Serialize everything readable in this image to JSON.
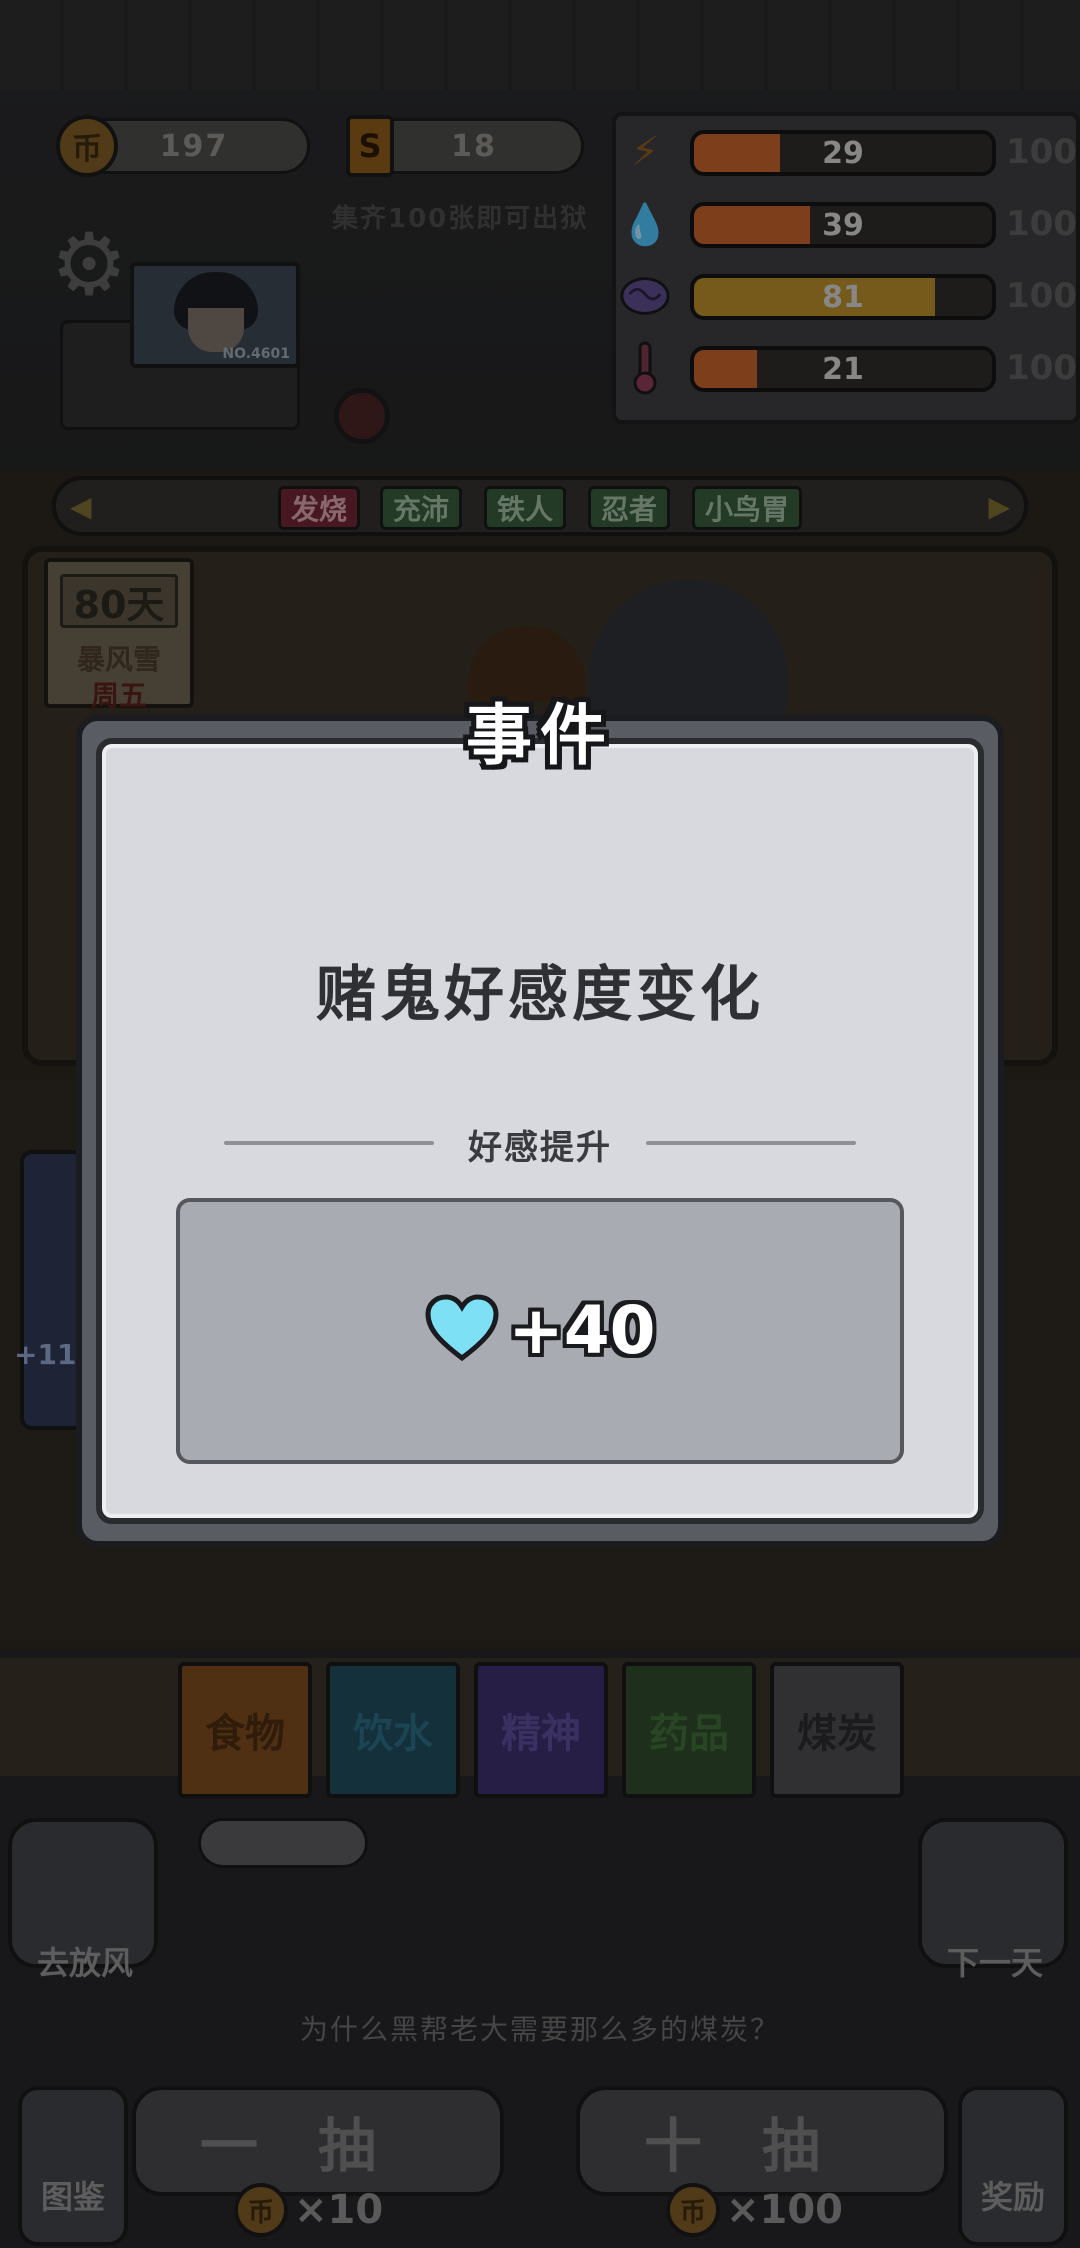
{
  "currency": {
    "coins": "197",
    "cards": "18",
    "coin_glyph": "币",
    "card_glyph": "S",
    "collect_hint": "集齐100张即可出狱"
  },
  "stats": {
    "max": "100",
    "items": [
      {
        "icon": "energy-bolt-icon",
        "value": "29",
        "fraction": 0.29,
        "color": "#c0622a"
      },
      {
        "icon": "water-drop-icon",
        "value": "39",
        "fraction": 0.39,
        "color": "#c0622a"
      },
      {
        "icon": "brain-icon",
        "value": "81",
        "fraction": 0.81,
        "color": "#b58a2a"
      },
      {
        "icon": "thermometer-icon",
        "value": "21",
        "fraction": 0.21,
        "color": "#c0622a"
      }
    ]
  },
  "player": {
    "portrait_number": "NO.4601"
  },
  "tags": [
    "发烧",
    "充沛",
    "铁人",
    "忍者",
    "小鸟胃"
  ],
  "calendar": {
    "days": "80天",
    "weather": "暴风雪",
    "weekday": "周五"
  },
  "room": {
    "card_bonus": "+11"
  },
  "categories": [
    {
      "label": "食物",
      "color": "#7a4a1e",
      "text": "#4a2c10"
    },
    {
      "label": "饮水",
      "color": "#1f4a5a",
      "text": "#2c6a82"
    },
    {
      "label": "精神",
      "color": "#3b2f6a",
      "text": "#5a4a96"
    },
    {
      "label": "药品",
      "color": "#2e4a2a",
      "text": "#3e6a38"
    },
    {
      "label": "煤炭",
      "color": "#4a4a4e",
      "text": "#2a2a2d"
    }
  ],
  "controls": {
    "go_out": "去放风",
    "next_day": "下一天",
    "tip": "为什么黑帮老大需要那么多的煤炭？",
    "draw_one": "一抽",
    "draw_ten": "十抽",
    "cost_one": "×10",
    "cost_ten": "×100",
    "collection": "图鉴",
    "reward": "奖励"
  },
  "modal": {
    "title": "事件",
    "headline": "赌鬼好感度变化",
    "subtitle": "好感提升",
    "reward_icon": "heart-icon",
    "reward_value": "+40",
    "heart_color": "#7ee0f5"
  }
}
